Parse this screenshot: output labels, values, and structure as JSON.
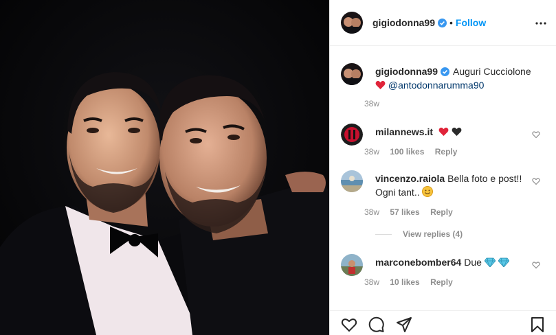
{
  "header": {
    "username": "gigiodonna99",
    "separator": "•",
    "follow_label": "Follow"
  },
  "caption": {
    "username": "gigiodonna99",
    "text": "Auguri Cucciolone",
    "mention": "@antodonnarumma90",
    "time": "38w"
  },
  "comments": [
    {
      "username": "milannews.it",
      "text": "",
      "time": "38w",
      "likes": "100 likes",
      "reply": "Reply"
    },
    {
      "username": "vincenzo.raiola",
      "text": "Bella foto e post!! Ogni tant..",
      "time": "38w",
      "likes": "57 likes",
      "reply": "Reply"
    },
    {
      "username": "marconebomber64",
      "text": "Due",
      "time": "38w",
      "likes": "10 likes",
      "reply": "Reply"
    }
  ],
  "view_replies": "View replies (4)",
  "colors": {
    "accent": "#0095f6",
    "verified": "#3897f0",
    "heart": "#ed4956",
    "muted": "#8e8e8e"
  },
  "icons": [
    "like-icon",
    "comment-icon",
    "share-icon",
    "bookmark-icon",
    "more-options-icon",
    "verified-badge-icon"
  ]
}
